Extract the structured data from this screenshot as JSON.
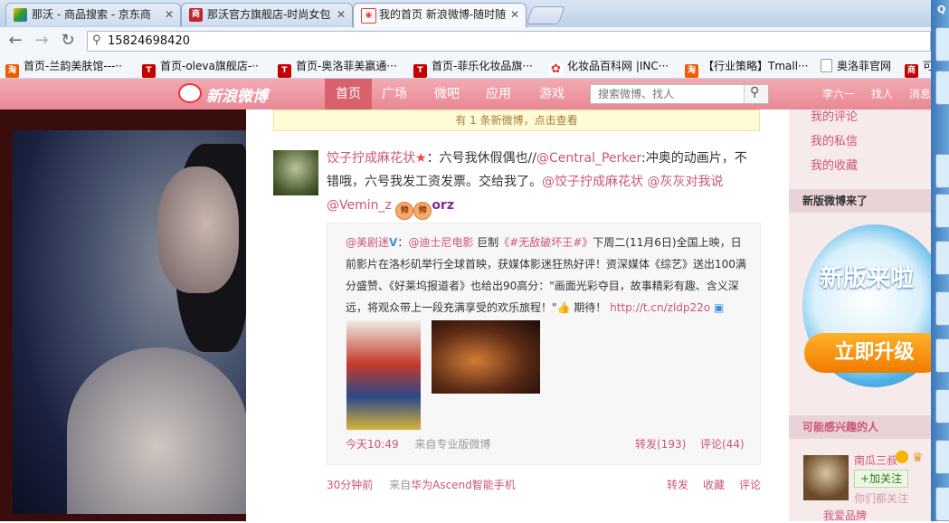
{
  "browser": {
    "tabs": [
      {
        "title": "那沃 - 商品搜索 - 京东商",
        "icon": "jd-favicon",
        "active": false
      },
      {
        "title": "那沃官方旗舰店-时尚女包",
        "icon": "shop-favicon",
        "active": false
      },
      {
        "title": "我的首页 新浪微博-随时随",
        "icon": "weibo-favicon",
        "active": true
      }
    ],
    "url": "15824698420",
    "bookmarks": [
      {
        "label": "首页-兰韵美肤馆---··",
        "icon": "taobao-icon"
      },
      {
        "label": "首页-oleva旗舰店-··",
        "icon": "tmall-icon"
      },
      {
        "label": "首页-奥洛菲美嬴通···",
        "icon": "tmall-icon"
      },
      {
        "label": "首页-菲乐化妆品旗···",
        "icon": "tmall-icon"
      },
      {
        "label": "化妆品百科网 |INC···",
        "icon": "flower-icon"
      },
      {
        "label": "【行业策略】Tmall···",
        "icon": "taobao-icon"
      },
      {
        "label": "奥洛菲官网",
        "icon": "page-icon"
      },
      {
        "label": "可",
        "icon": "shop-icon"
      }
    ]
  },
  "weibo": {
    "logo": "新浪微博",
    "nav": [
      "首页",
      "广场",
      "微吧",
      "应用",
      "游戏"
    ],
    "search_placeholder": "搜索微博、找人",
    "user_links": [
      "李六一",
      "找人",
      "消息"
    ],
    "notice": "有 1 条新微博，点击查看",
    "post": {
      "author": "饺子拧成麻花状",
      "segments": [
        "：六号我休假偶也//",
        "@Central_Perker",
        ":冲奥的动画片，不错哦，六号我发工资发票。交给我了。",
        "@饺子拧成麻花状",
        " ",
        "@灰灰对我说",
        " ",
        "@Vemin_z"
      ],
      "emoticons": [
        "帅",
        "帅"
      ],
      "emoticon_tail": "orz",
      "time": "30分钟前",
      "source_prefix": "来自",
      "source": "华为Ascend智能手机",
      "actions": [
        "转发",
        "收藏",
        "评论"
      ]
    },
    "repost": {
      "author": "@美剧迷",
      "text_1": "：",
      "mention": "@迪士尼电影",
      "text_2": " 巨制",
      "topic": "《#无敌破坏王#》",
      "text_3": "下周二(11月6日)全国上映，日前影片在洛杉矶举行全球首映，获媒体影迷狂热好评！资深媒体《综艺》送出100满分盛赞、《好莱坞报道者》也给出90高分：\"画面光彩夺目，故事精彩有趣、含义深远，将观众带上一段充满享受的欢乐旅程！\"",
      "text_4": " 期待！",
      "link": "http://t.cn/zldp22o",
      "time": "今天10:49",
      "source": "来自专业版微博",
      "forward": "转发(193)",
      "comment": "评论(44)"
    },
    "sidebar": {
      "links": [
        "我的评论",
        "我的私信",
        "我的收藏"
      ],
      "new_version_title": "新版微博来了",
      "banner_title": "新版来啦",
      "banner_button": "立即升级",
      "recommend_title": "可能感兴趣的人",
      "recommend_name": "南瓜三叔",
      "follow_label": "+加关注",
      "mutual": "你们都关注",
      "bottom_link": "我爱品牌"
    }
  },
  "colors": {
    "weibo_pink": "#e88995",
    "link": "#cc5577",
    "orange": "#f07b00"
  }
}
